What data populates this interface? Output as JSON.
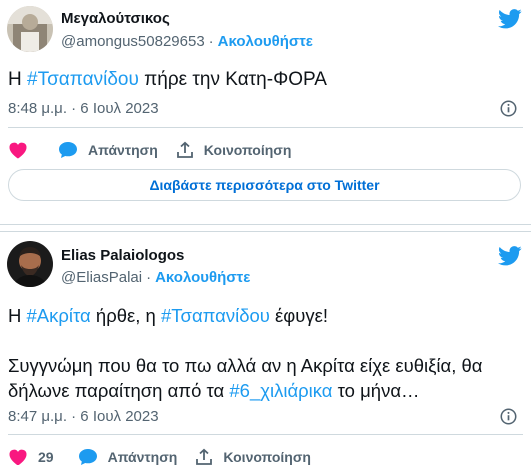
{
  "colors": {
    "accent": "#1d9bf0",
    "like": "#f91880",
    "muted": "#536471",
    "text": "#0f1419"
  },
  "tweets": [
    {
      "author_name": "Μεγαλούτσικος",
      "handle": "@amongus50829653",
      "separator": "·",
      "follow_label": "Ακολουθήστε",
      "text_parts": [
        "Η ",
        "#Τσαπανίδου",
        " πήρε την Κατη-ΦΟΡΑ"
      ],
      "timestamp": "8:48 μ.μ. · 6 Ιουλ 2023",
      "like_count": "",
      "reply_label": "Απάντηση",
      "share_label": "Κοινοποίηση",
      "read_more_label": "Διαβάστε περισσότερα στο Twitter",
      "icons": [
        "twitter-bird-icon",
        "info-icon",
        "heart-icon",
        "reply-bubble-icon",
        "share-icon"
      ]
    },
    {
      "author_name": "Elias Palaiologos",
      "handle": "@EliasPalai",
      "separator": "·",
      "follow_label": "Ακολουθήστε",
      "text_parts": [
        "Η ",
        "#Ακρίτα",
        " ήρθε, η ",
        "#Τσαπανίδου",
        " έφυγε!",
        "\n\nΣυγγνώμη που θα το πω αλλά αν η Ακρίτα είχε ευθιξία, θα δήλωνε παραίτηση από τα ",
        "#6_χιλιάρικα",
        " το μήνα…"
      ],
      "timestamp": "8:47 μ.μ. · 6 Ιουλ 2023",
      "like_count": "29",
      "reply_label": "Απάντηση",
      "share_label": "Κοινοποίηση",
      "icons": [
        "twitter-bird-icon",
        "info-icon",
        "heart-icon",
        "reply-bubble-icon",
        "share-icon"
      ]
    }
  ]
}
